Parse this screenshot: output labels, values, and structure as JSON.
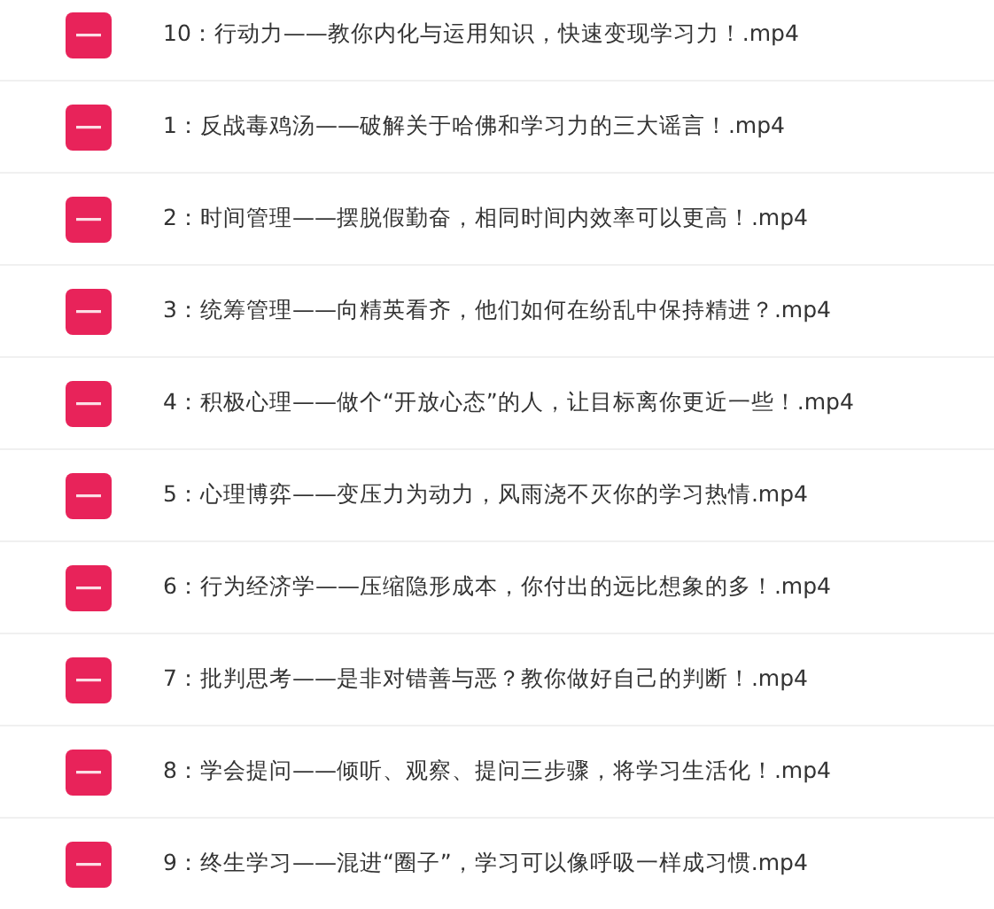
{
  "files": [
    {
      "name": "10：行动力——教你内化与运用知识，快速变现学习力！.mp4"
    },
    {
      "name": "1：反战毒鸡汤——破解关于哈佛和学习力的三大谣言！.mp4"
    },
    {
      "name": "2：时间管理——摆脱假勤奋，相同时间内效率可以更高！.mp4"
    },
    {
      "name": "3：统筹管理——向精英看齐，他们如何在纷乱中保持精进？.mp4"
    },
    {
      "name": "4：积极心理——做个“开放心态”的人，让目标离你更近一些！.mp4"
    },
    {
      "name": "5：心理博弈——变压力为动力，风雨浇不灭你的学习热情.mp4"
    },
    {
      "name": "6：行为经济学——压缩隐形成本，你付出的远比想象的多！.mp4"
    },
    {
      "name": "7：批判思考——是非对错善与恶？教你做好自己的判断！.mp4"
    },
    {
      "name": "8：学会提问——倾听、观察、提问三步骤，将学习生活化！.mp4"
    },
    {
      "name": "9：终生学习——混进“圈子”，学习可以像呼吸一样成习惯.mp4"
    }
  ]
}
